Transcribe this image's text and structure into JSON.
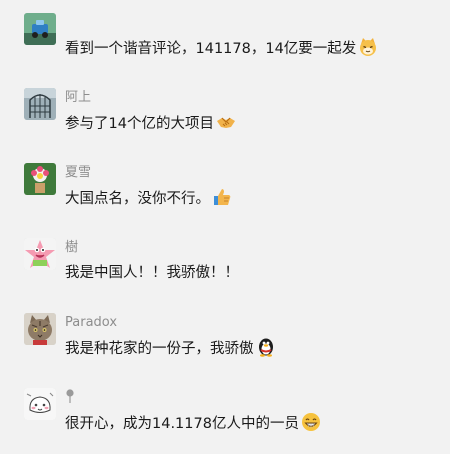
{
  "comments": [
    {
      "name": "",
      "text": "看到一个谐音评论，141178，14亿要一起发",
      "avatar_icon": "toy-car-avatar",
      "emoji_icon": "cat-face-emoji"
    },
    {
      "name": "阿上",
      "text": "参与了14个亿的大项目",
      "avatar_icon": "birdcage-avatar",
      "emoji_icon": "handshake-emoji"
    },
    {
      "name": "夏雪",
      "text": "大国点名，没你不行。",
      "avatar_icon": "flower-avatar",
      "emoji_icon": "thumbs-up-emoji"
    },
    {
      "name": "樹",
      "text": "我是中国人！！我骄傲！！",
      "avatar_icon": "patrick-star-avatar",
      "emoji_icon": ""
    },
    {
      "name": "Paradox",
      "text": "我是种花家的一份子，我骄傲",
      "avatar_icon": "cat-photo-avatar",
      "emoji_icon": "penguin-emoji"
    },
    {
      "name": "",
      "text": "很开心，成为14.1178亿人中的一员",
      "avatar_icon": "cartoon-sketch-avatar",
      "emoji_icon": "grin-emoji",
      "name_icon": "map-pin-icon"
    }
  ]
}
